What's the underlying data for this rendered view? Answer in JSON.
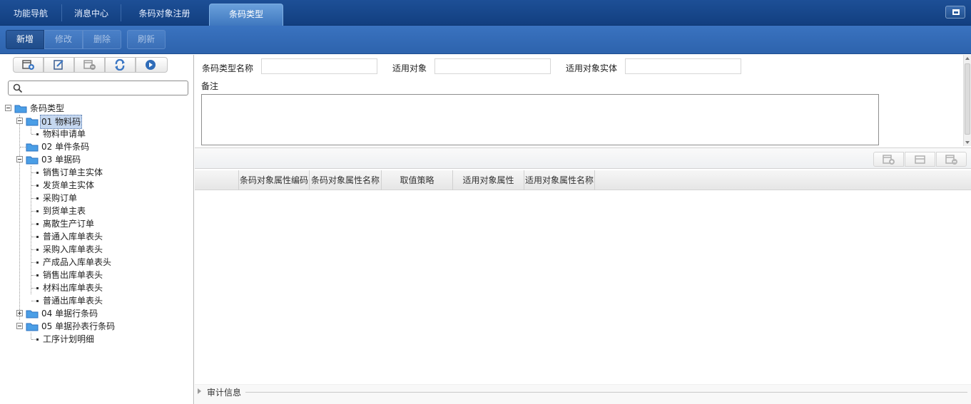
{
  "top_tabs": [
    {
      "label": "功能导航"
    },
    {
      "label": "消息中心"
    },
    {
      "label": "条码对象注册"
    },
    {
      "label": "条码类型",
      "active": true
    }
  ],
  "actions": {
    "new": "新增",
    "edit": "修改",
    "delete": "删除",
    "refresh": "刷新"
  },
  "tree_toolbar_icons": [
    "add-folder-icon",
    "edit-icon",
    "delete-folder-icon",
    "refresh-icon",
    "play-icon"
  ],
  "search": {
    "placeholder": ""
  },
  "tree": {
    "root": "条码类型",
    "n01": "01 物料码",
    "n01_children": [
      "物料申请单"
    ],
    "n02": "02 单件条码",
    "n03": "03 单据码",
    "n03_children": [
      "销售订单主实体",
      "发货单主实体",
      "采购订单",
      "到货单主表",
      "离散生产订单",
      "普通入库单表头",
      "采购入库单表头",
      "产成品入库单表头",
      "销售出库单表头",
      "材料出库单表头",
      "普通出库单表头"
    ],
    "n04": "04 单据行条码",
    "n05": "05 单据孙表行条码",
    "n05_children": [
      "工序计划明细"
    ]
  },
  "form": {
    "type_name_label": "条码类型名称",
    "type_name_value": "",
    "target_label": "适用对象",
    "target_value": "",
    "target_entity_label": "适用对象实体",
    "target_entity_value": "",
    "remark_label": "备注",
    "remark_value": ""
  },
  "grid": {
    "columns": [
      "条码对象属性编码",
      "条码对象属性名称",
      "取值策略",
      "适用对象属性",
      "适用对象属性名称"
    ],
    "rows": []
  },
  "grid_toolbar_icons": [
    "add-row-icon",
    "insert-row-icon",
    "delete-row-icon"
  ],
  "audit": {
    "label": "审计信息"
  },
  "colors": {
    "header_blue": "#1d4f96",
    "toolbar_blue": "#3a73c0",
    "active_tab": "#5a91d4",
    "folder_blue": "#4a9ee6"
  }
}
